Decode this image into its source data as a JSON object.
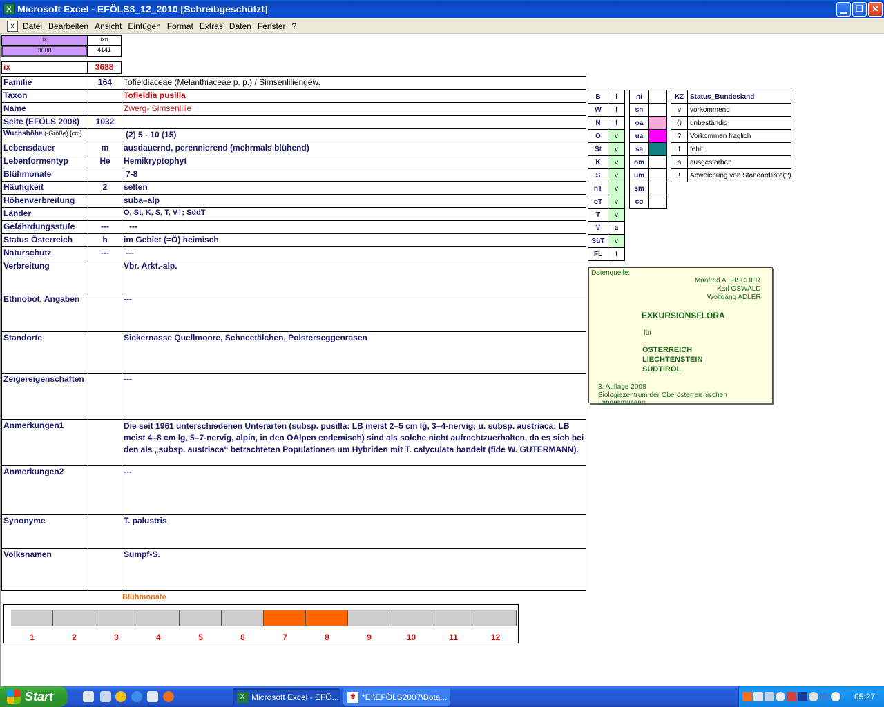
{
  "window": {
    "title": "Microsoft Excel - EFÖLS3_12_2010  [Schreibgeschützt]",
    "app_icon": "excel-icon",
    "buttons": {
      "minimize": "▁",
      "restore": "❐",
      "close": "✕"
    }
  },
  "menu": {
    "items": [
      "Datei",
      "Bearbeiten",
      "Ansicht",
      "Einfügen",
      "Format",
      "Extras",
      "Daten",
      "Fenster",
      "?"
    ],
    "mdi_buttons": {
      "minimize": "_",
      "restore": "❐",
      "close": "✕"
    }
  },
  "top_cells": {
    "ix_header": "ix",
    "ixn_header": "ixn",
    "ix_value": "3688",
    "ixn_value": "4141",
    "ix_label": "ix",
    "ix_big": "3688"
  },
  "rows": [
    {
      "label": "Familie",
      "num": "164",
      "value": "Tofieldiaceae (Melanthiaceae p. p.)  /  Simsenliliengew."
    },
    {
      "label": "Taxon",
      "num": "",
      "value": "Tofieldia pusilla"
    },
    {
      "label": "Name",
      "num": "",
      "value": "Zwerg- Simsenlilie"
    },
    {
      "label": "Seite (EFÖLS 2008)",
      "num": "1032",
      "value": ""
    },
    {
      "label": "Wuchshöhe",
      "label_sub": "(-Größe) [cm]",
      "num": "",
      "value": "(2) 5 - 10 (15)"
    },
    {
      "label": "Lebensdauer",
      "num": "m",
      "value": "ausdauernd, perennierend (mehrmals blühend)"
    },
    {
      "label": "Lebenformentyp",
      "num": "He",
      "value": "Hemikryptophyt"
    },
    {
      "label": "Blühmonate",
      "num": "",
      "value": "7-8"
    },
    {
      "label": "Häufigkeit",
      "num": "2",
      "value": "selten"
    },
    {
      "label": "Höhenverbreitung",
      "num": "",
      "value": "suba–alp"
    },
    {
      "label": "Länder",
      "num": "",
      "value": "O, St, K, S, T, V†; SüdT"
    },
    {
      "label": "Gefährdungsstufe",
      "num": "---",
      "value": "---"
    },
    {
      "label": "Status Österreich",
      "num": "h",
      "value": "im Gebiet (=Ö) heimisch"
    },
    {
      "label": "Naturschutz",
      "num": "---",
      "value": "---"
    },
    {
      "label": "Verbreitung",
      "num": "",
      "value": "Vbr. Arkt.-alp."
    },
    {
      "label": "Ethnobot. Angaben",
      "num": "",
      "value": "---"
    },
    {
      "label": "Standorte",
      "num": "",
      "value": "Sickernasse Quellmoore, Schneetälchen, Polsterseggenrasen"
    },
    {
      "label": "Zeigereigenschaften",
      "num": "",
      "value": "---"
    },
    {
      "label": "Anmerkungen1",
      "num": "",
      "value": "Die seit 1961 unterschiedenen Unterarten (subsp. pusilla: LB meist 2–5 cm lg, 3–4-nervig; u. subsp. austriaca: LB meist 4–8 cm lg, 5–7-nervig, alpin, in den OAlpen endemisch) sind als solche nicht aufrechtzuerhalten, da es sich bei den als „subsp. austriaca“ betrachteten Populationen um Hybriden mit T. calyculata handelt (fide W. GUTERMANN)."
    },
    {
      "label": "Anmerkungen2",
      "num": "",
      "value": "---"
    },
    {
      "label": "Synonyme",
      "num": "",
      "value": "T. palustris"
    },
    {
      "label": "Volksnamen",
      "num": "",
      "value": "Sumpf-S."
    }
  ],
  "bundeslaender": [
    {
      "code": "B",
      "status": "f"
    },
    {
      "code": "W",
      "status": "f"
    },
    {
      "code": "N",
      "status": "f"
    },
    {
      "code": "O",
      "status": "v"
    },
    {
      "code": "St",
      "status": "v"
    },
    {
      "code": "K",
      "status": "v"
    },
    {
      "code": "S",
      "status": "v"
    },
    {
      "code": "nT",
      "status": "v"
    },
    {
      "code": "oT",
      "status": "v"
    },
    {
      "code": "T",
      "status": "v"
    },
    {
      "code": "V",
      "status": "a"
    },
    {
      "code": "SüT",
      "status": "v"
    },
    {
      "code": "FL",
      "status": "f"
    }
  ],
  "hoehenstufen": [
    {
      "code": "ni",
      "color": ""
    },
    {
      "code": "sn",
      "color": ""
    },
    {
      "code": "oa",
      "color": "#f7a8d8"
    },
    {
      "code": "ua",
      "color": "#ff00ff"
    },
    {
      "code": "sa",
      "color": "#108080"
    },
    {
      "code": "om",
      "color": ""
    },
    {
      "code": "um",
      "color": ""
    },
    {
      "code": "sm",
      "color": ""
    },
    {
      "code": "co",
      "color": ""
    }
  ],
  "legend": {
    "header_kz": "KZ",
    "header": "Status_Bundesland",
    "items": [
      {
        "kz": "v",
        "desc": "vorkommend"
      },
      {
        "kz": "()",
        "desc": "unbeständig"
      },
      {
        "kz": "?",
        "desc": "Vorkommen fraglich"
      },
      {
        "kz": "f",
        "desc": "fehlt"
      },
      {
        "kz": "a",
        "desc": "ausgestorben"
      },
      {
        "kz": "!",
        "desc": "Abweichung von Standardliste(?)"
      }
    ]
  },
  "source": {
    "label": "Datenquelle:",
    "authors": [
      "Manfred A. FISCHER",
      "Karl OSWALD",
      "Wolfgang ADLER"
    ],
    "title": "EXKURSIONSFLORA",
    "fuer": "für",
    "countries": [
      "ÖSTERREICH",
      "LIECHTENSTEIN",
      "SÜDTIROL"
    ],
    "edition": "3. Auflage 2008",
    "publisher": "Biologiezentrum der Oberösterreichischen Landesmuseen"
  },
  "chart_data": {
    "type": "bar",
    "title": "Blühmonate",
    "categories": [
      "1",
      "2",
      "3",
      "4",
      "5",
      "6",
      "7",
      "8",
      "9",
      "10",
      "11",
      "12"
    ],
    "values": [
      0,
      0,
      0,
      0,
      0,
      0,
      1,
      1,
      0,
      0,
      0,
      0
    ],
    "colors": {
      "bloom": "#ff6600",
      "off": "#cccccc"
    }
  },
  "taskbar": {
    "start_label": "Start",
    "tasks": [
      {
        "label": "Microsoft Excel - EFÖ...",
        "icon": "excel-icon"
      },
      {
        "label": "*E:\\EFÖLS2007\\Bota...",
        "icon": "document-icon"
      }
    ],
    "clock": "05:27"
  }
}
